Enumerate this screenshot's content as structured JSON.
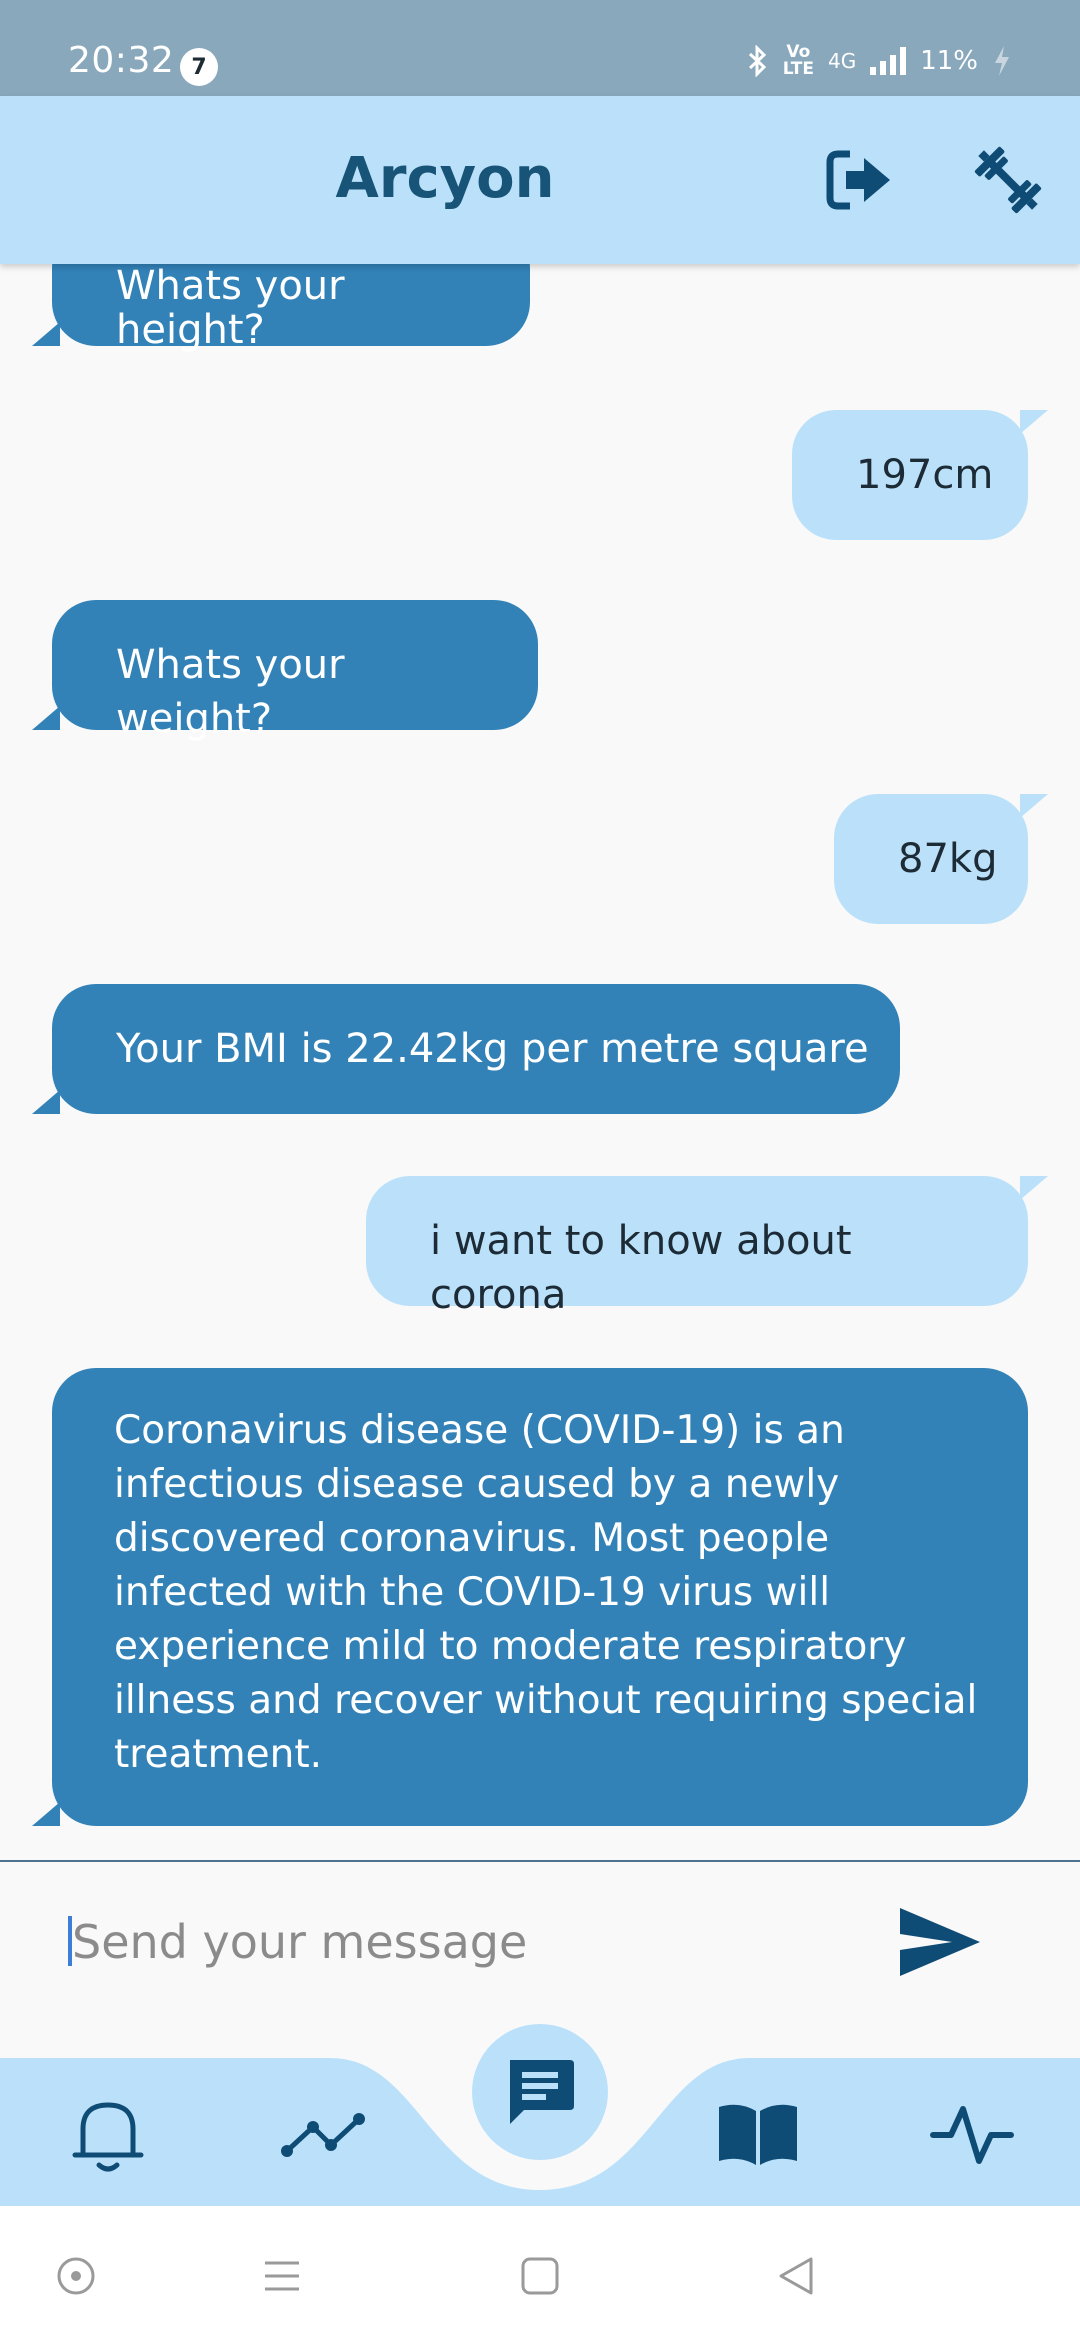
{
  "status_bar": {
    "time": "20:32",
    "notification_count": "7",
    "network": "4G",
    "volte": "Vo\nLTE",
    "battery": "11%"
  },
  "app_bar": {
    "title": "Arcyon",
    "logout_icon": "logout-icon",
    "fitness_icon": "dumbbell-icon"
  },
  "messages": [
    {
      "sender": "bot",
      "text": "Whats your height?"
    },
    {
      "sender": "user",
      "text": "197cm"
    },
    {
      "sender": "bot",
      "text": "Whats your weight?"
    },
    {
      "sender": "user",
      "text": "87kg"
    },
    {
      "sender": "bot",
      "text": "Your BMI is 22.42kg per metre square"
    },
    {
      "sender": "user",
      "text": "i want to know about corona"
    },
    {
      "sender": "bot",
      "lines": [
        "Coronavirus disease (COVID-19) is an",
        "infectious disease caused by a newly",
        "discovered coronavirus. Most people",
        "infected with the COVID-19 virus will",
        "experience mild to moderate respiratory",
        "illness and recover without requiring special",
        "treatment."
      ]
    }
  ],
  "composer": {
    "placeholder": "Send your message",
    "send_icon": "send-icon"
  },
  "bottom_nav": {
    "items": [
      "bell-icon",
      "chart-line-icon",
      "chat-icon",
      "book-icon",
      "activity-icon"
    ],
    "active": "chat-icon"
  },
  "colors": {
    "status_bar": "#89a8bc",
    "app_bar": "#bbe0f9",
    "bot_bubble": "#3282b8",
    "user_bubble": "#bbe1fa",
    "accent_dark": "#175477",
    "icon_dark": "#0f4c75"
  }
}
